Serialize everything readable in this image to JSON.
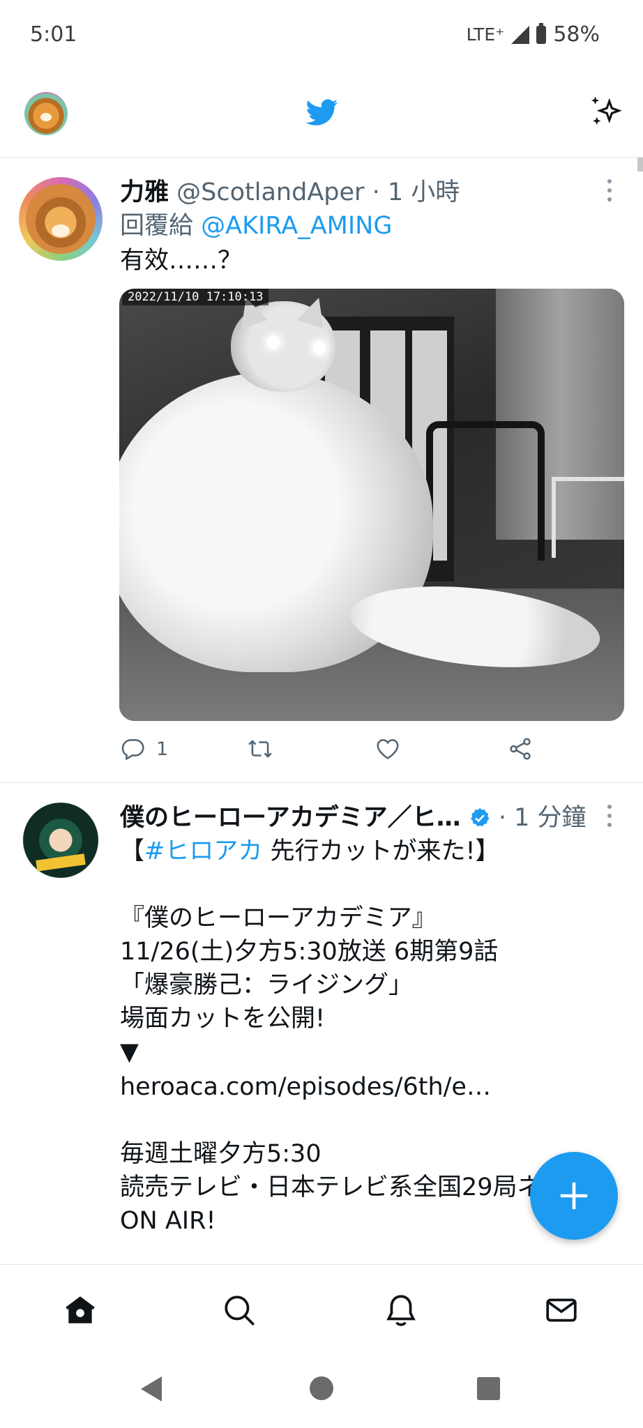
{
  "status_bar": {
    "time": "5:01",
    "network": "LTE⁺",
    "battery": "58%"
  },
  "header": {
    "logo": "twitter-bird-icon",
    "avatar": "profile-avatar",
    "sparkle": "sparkle-icon"
  },
  "tweets": [
    {
      "display_name": "力雅",
      "handle": "@ScotlandAper",
      "time": "· 1 小時",
      "reply_prefix": "回覆給",
      "reply_to": "@AKIRA_AMING",
      "text": "有效……？",
      "media": {
        "timestamp": "2022/11/10  17:10:13"
      },
      "stats": {
        "replies": "1",
        "retweets": "",
        "likes": ""
      }
    },
    {
      "display_name": "僕のヒーローアカデミア／ヒ…",
      "time": "· 1 分鐘",
      "verified": true,
      "line1_open": "【",
      "hashtag": "#ヒロアカ",
      "line1_rest": " 先行カットが来た!】",
      "body": "『僕のヒーローアカデミア』\n11/26(土)夕方5:30放送 6期第9話\n「爆豪勝己：ライジング」\n場面カットを公開!\n▼",
      "link": "heroaca.com/episodes/6th/e…",
      "footer": "毎週土曜夕方5:30\n読売テレビ・日本テレビ系全国29局ネ\nON AIR!"
    }
  ],
  "colors": {
    "accent": "#1d9bf0",
    "text": "#0f1419",
    "muted": "#536471"
  },
  "nav": [
    "home-icon",
    "search-icon",
    "notifications-icon",
    "messages-icon"
  ]
}
